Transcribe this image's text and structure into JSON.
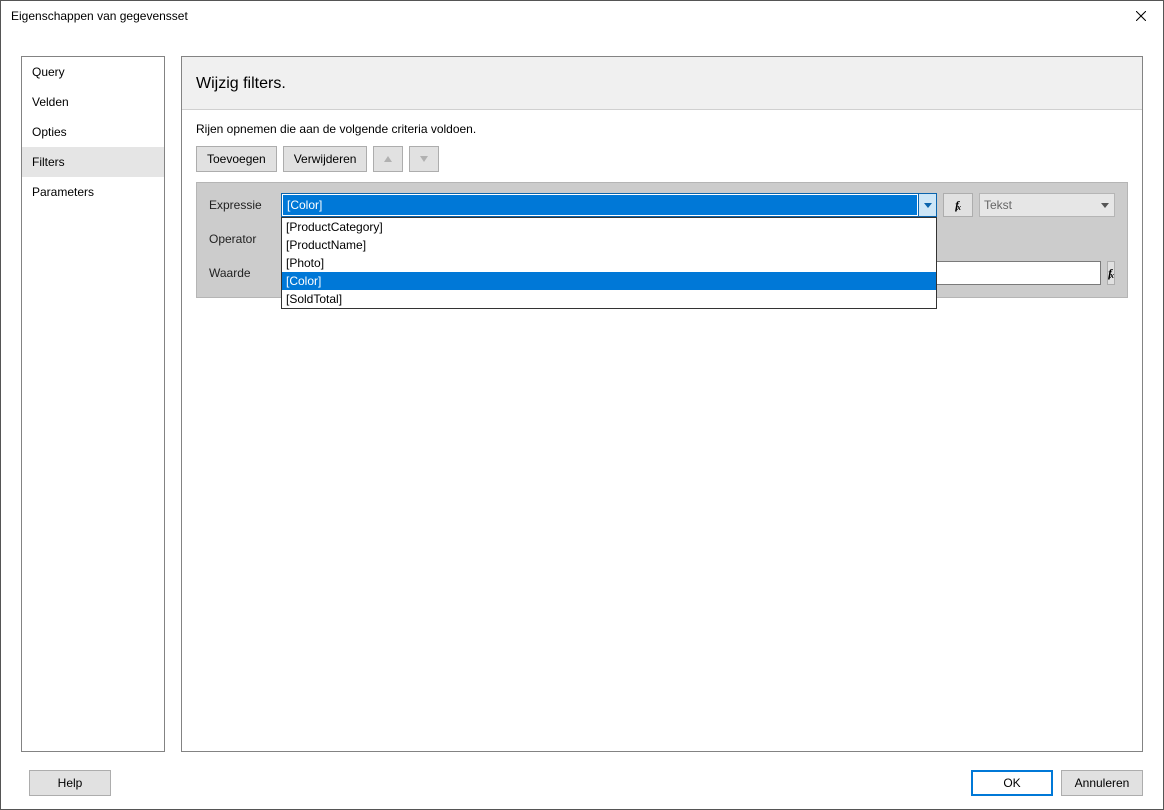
{
  "window": {
    "title": "Eigenschappen van gegevensset"
  },
  "sidebar": {
    "items": [
      {
        "label": "Query"
      },
      {
        "label": "Velden"
      },
      {
        "label": "Opties"
      },
      {
        "label": "Filters"
      },
      {
        "label": "Parameters"
      }
    ],
    "selected_index": 3
  },
  "main": {
    "heading": "Wijzig filters.",
    "instruction": "Rijen opnemen die aan de volgende criteria voldoen.",
    "buttons": {
      "add": "Toevoegen",
      "delete": "Verwijderen"
    },
    "labels": {
      "expression": "Expressie",
      "operator": "Operator",
      "value": "Waarde"
    },
    "expression_value": "[Color]",
    "type_value": "Tekst",
    "expression_options": [
      "[ProductCategory]",
      "[ProductName]",
      "[Photo]",
      "[Color]",
      "[SoldTotal]"
    ],
    "highlighted_option_index": 3
  },
  "footer": {
    "help": "Help",
    "ok": "OK",
    "cancel": "Annuleren"
  },
  "fx_label": "ƒ𝑥"
}
